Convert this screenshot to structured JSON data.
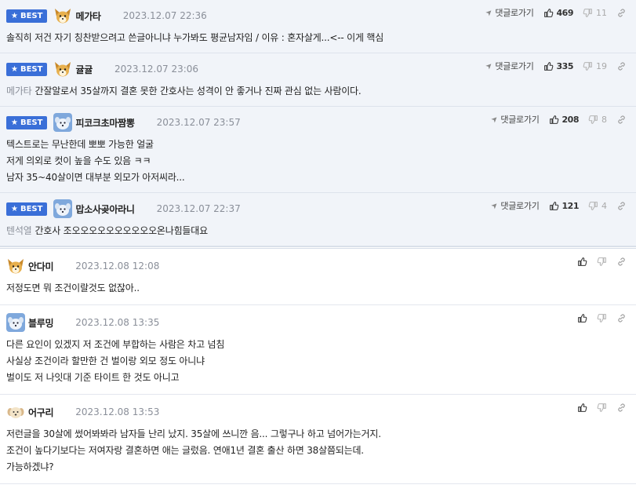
{
  "best_label": "BEST",
  "reply_label": "댓글로가기",
  "icons": {
    "best_star": "star-icon",
    "reply": "reply-arrow-icon",
    "up": "thumbs-up-icon",
    "down": "thumbs-down-icon",
    "share": "link-icon"
  },
  "colors": {
    "best_bg": "#f1f4f9",
    "badge": "#3a6fd8",
    "date": "#8a8f99"
  },
  "best_comments": [
    {
      "nick": "메가타",
      "avatar": "fox",
      "date": "2023.12.07 22:36",
      "up": "469",
      "down": "11",
      "ref": "",
      "lines": [
        "솔직히 저건 자기 칭찬받으려고 쓴글아니냐 누가봐도 평균남자임 / 이유 : 혼자살게...<-- 이게 핵심"
      ]
    },
    {
      "nick": "귤귤",
      "avatar": "fox",
      "date": "2023.12.07 23:06",
      "up": "335",
      "down": "19",
      "ref": "메가타",
      "lines": [
        "간잘알로서 35살까지 결혼 못한 간호사는 성격이 안 좋거나 진짜 관심 없는 사람이다."
      ]
    },
    {
      "nick": "피코크초마짬뽕",
      "avatar": "dog",
      "date": "2023.12.07 23:57",
      "up": "208",
      "down": "8",
      "ref": "",
      "lines": [
        "텍스트로는 무난한데 뽀뽀 가능한 얼굴",
        "저게 의외로 컷이 높을 수도 있음 ㅋㅋ",
        "남자 35~40살이면 대부분 외모가 아저씨라..."
      ]
    },
    {
      "nick": "맙소사곶아라니",
      "avatar": "dog",
      "date": "2023.12.07 22:37",
      "up": "121",
      "down": "4",
      "ref": "텐석열",
      "lines": [
        "간호사 조오오오오오오오오오오온나힘들대요"
      ]
    }
  ],
  "comments": [
    {
      "nick": "안다미",
      "avatar": "fox",
      "date": "2023.12.08 12:08",
      "lines": [
        "저정도면 뭐 조건이랄것도 없잖아.."
      ]
    },
    {
      "nick": "블루밍",
      "avatar": "dog",
      "date": "2023.12.08 13:35",
      "lines": [
        "다른 요인이 있겠지 저 조건에 부합하는 사람은 차고 넘침",
        "사실상 조건이라 할만한 건 벌이랑 외모 정도 아니냐",
        "벌이도 저 나잇대 기준 타이트 한 것도 아니고"
      ]
    },
    {
      "nick": "어구리",
      "avatar": "puppy",
      "date": "2023.12.08 13:53",
      "lines": [
        "저런글을 30살에 썼어봐봐라 남자들 난리 났지. 35살에 쓰니깐 음... 그렇구나 하고 넘어가는거지.",
        "조건이 높다기보다는 저여자랑 결혼하면 애는 글렀음. 연애1년 결혼 출산 하면 38살쯤되는데.",
        "가능하겠냐?"
      ]
    }
  ]
}
